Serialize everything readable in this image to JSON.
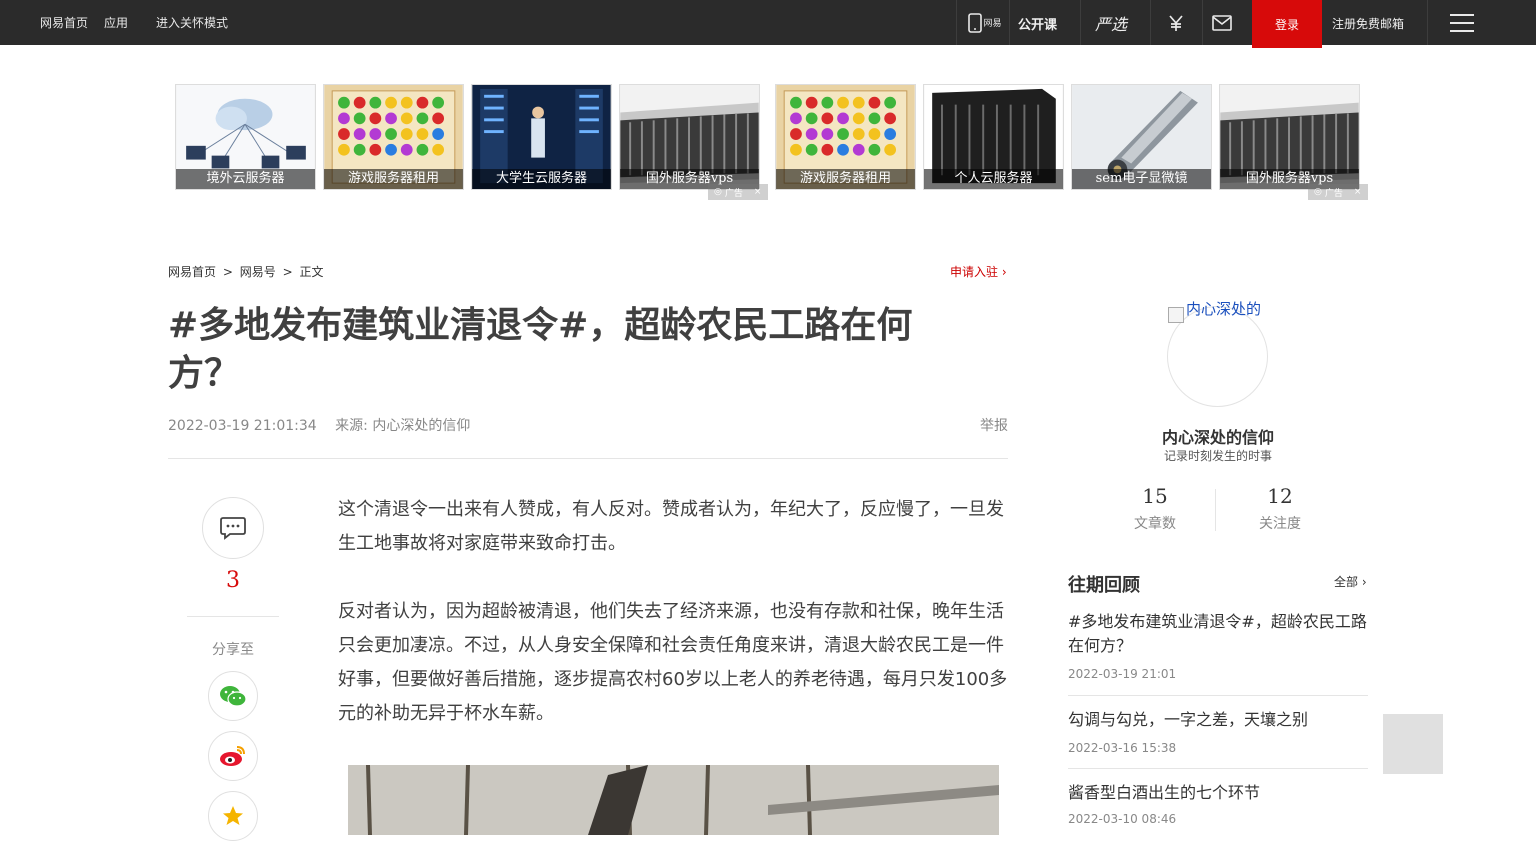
{
  "topbar": {
    "home": "网易首页",
    "apps": "应用",
    "care_mode": "进入关怀模式",
    "app_badge": "网易",
    "open_course": "公开课",
    "yanxuan": "严选",
    "login": "登录",
    "register": "注册免费邮箱"
  },
  "ads": {
    "row1": [
      "境外云服务器",
      "游戏服务器租用",
      "大学生云服务器",
      "国外服务器vps"
    ],
    "row2": [
      "游戏服务器租用",
      "个人云服务器",
      "sem电子显微镜",
      "国外服务器vps"
    ],
    "mark": "广告"
  },
  "breadcrumb": {
    "home": "网易首页",
    "sep": ">",
    "hao": "网易号",
    "current": "正文",
    "apply": "申请入驻"
  },
  "article": {
    "title": "#多地发布建筑业清退令#，超龄农民工路在何方？",
    "datetime": "2022-03-19 21:01:34",
    "source": "来源: 内心深处的信仰",
    "report": "举报",
    "paragraphs": [
      "这个清退令一出来有人赞成，有人反对。赞成者认为，年纪大了，反应慢了，一旦发生工地事故将对家庭带来致命打击。",
      "反对者认为，因为超龄被清退，他们失去了经济来源，也没有存款和社保，晚年生活只会更加凄凉。不过，从人身安全保障和社会责任角度来讲，清退大龄农民工是一件好事，但要做好善后措施，逐步提高农村60岁以上老人的养老待遇，每月只发100多元的补助无异于杯水车薪。"
    ]
  },
  "share": {
    "comment_count": "3",
    "label": "分享至"
  },
  "author": {
    "avatar_alt": "内心深处的",
    "name": "内心深处的信仰",
    "motto": "记录时刻发生的时事",
    "articles_count": "15",
    "articles_label": "文章数",
    "follow_count": "12",
    "follow_label": "关注度"
  },
  "past": {
    "title": "往期回顾",
    "all": "全部",
    "items": [
      {
        "title": "#多地发布建筑业清退令#，超龄农民工路在何方？",
        "date": "2022-03-19 21:01"
      },
      {
        "title": "勾调与勾兑，一字之差，天壤之别",
        "date": "2022-03-16 15:38"
      },
      {
        "title": "酱香型白酒出生的七个环节",
        "date": "2022-03-10 08:46"
      }
    ]
  }
}
